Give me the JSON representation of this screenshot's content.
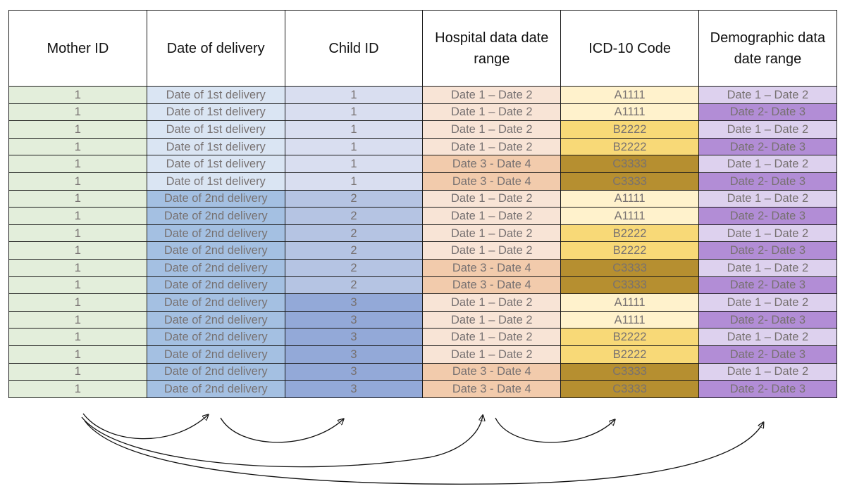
{
  "table": {
    "columns": [
      "Mother ID",
      "Date of delivery",
      "Child ID",
      "Hospital data date range",
      "ICD-10 Code",
      "Demographic data date range"
    ],
    "rows": [
      [
        "1",
        "Date of 1st delivery",
        "1",
        "Date 1 – Date 2",
        "A1111",
        "Date 1 – Date 2"
      ],
      [
        "1",
        "Date of 1st delivery",
        "1",
        "Date 1 – Date 2",
        "A1111",
        "Date 2- Date 3"
      ],
      [
        "1",
        "Date of 1st delivery",
        "1",
        "Date 1 – Date 2",
        "B2222",
        "Date 1 – Date 2"
      ],
      [
        "1",
        "Date of 1st delivery",
        "1",
        "Date 1 – Date 2",
        "B2222",
        "Date 2- Date 3"
      ],
      [
        "1",
        "Date of 1st delivery",
        "1",
        "Date 3 - Date 4",
        "C3333",
        "Date 1 – Date 2"
      ],
      [
        "1",
        "Date of 1st delivery",
        "1",
        "Date 3 - Date 4",
        "C3333",
        "Date 2- Date 3"
      ],
      [
        "1",
        "Date of 2nd delivery",
        "2",
        "Date 1 – Date 2",
        "A1111",
        "Date 1 – Date 2"
      ],
      [
        "1",
        "Date of 2nd delivery",
        "2",
        "Date 1 – Date 2",
        "A1111",
        "Date 2- Date 3"
      ],
      [
        "1",
        "Date of 2nd delivery",
        "2",
        "Date 1 – Date 2",
        "B2222",
        "Date 1 – Date 2"
      ],
      [
        "1",
        "Date of 2nd delivery",
        "2",
        "Date 1 – Date 2",
        "B2222",
        "Date 2- Date 3"
      ],
      [
        "1",
        "Date of 2nd delivery",
        "2",
        "Date 3 - Date 4",
        "C3333",
        "Date 1 – Date 2"
      ],
      [
        "1",
        "Date of 2nd delivery",
        "2",
        "Date 3 - Date 4",
        "C3333",
        "Date 2- Date 3"
      ],
      [
        "1",
        "Date of 2nd delivery",
        "3",
        "Date 1 – Date 2",
        "A1111",
        "Date 1 – Date 2"
      ],
      [
        "1",
        "Date of 2nd delivery",
        "3",
        "Date 1 – Date 2",
        "A1111",
        "Date 2- Date 3"
      ],
      [
        "1",
        "Date of 2nd delivery",
        "3",
        "Date 1 – Date 2",
        "B2222",
        "Date 1 – Date 2"
      ],
      [
        "1",
        "Date of 2nd delivery",
        "3",
        "Date 1 – Date 2",
        "B2222",
        "Date 2- Date 3"
      ],
      [
        "1",
        "Date of 2nd delivery",
        "3",
        "Date 3 - Date 4",
        "C3333",
        "Date 1 – Date 2"
      ],
      [
        "1",
        "Date of 2nd delivery",
        "3",
        "Date 3 - Date 4",
        "C3333",
        "Date 2- Date 3"
      ]
    ]
  },
  "colors": {
    "mother_id": {
      "1": "#e3eedb"
    },
    "delivery": {
      "Date of 1st delivery": "#dae5f3",
      "Date of 2nd delivery": "#a4c0e2"
    },
    "child_id": {
      "1": "#d9def0",
      "2": "#b5c4e3",
      "3": "#93a9d8"
    },
    "hospital_range": {
      "Date 1 – Date 2": "#f8e4d6",
      "Date 3 - Date 4": "#f2cbac"
    },
    "icd10": {
      "A1111": "#fff2cc",
      "B2222": "#f8d977",
      "C3333": "#b68f30"
    },
    "demographic_range": {
      "Date 1 – Date 2": "#ddd1ee",
      "Date 2- Date 3": "#b28dd6"
    }
  },
  "arrows": [
    {
      "from": "Mother ID",
      "to": "Date of delivery"
    },
    {
      "from": "Date of delivery",
      "to": "Child ID"
    },
    {
      "from": "Mother ID",
      "to": "Hospital data date range"
    },
    {
      "from": "Hospital data date range",
      "to": "ICD-10 Code"
    },
    {
      "from": "Mother ID",
      "to": "Demographic data date range"
    }
  ]
}
